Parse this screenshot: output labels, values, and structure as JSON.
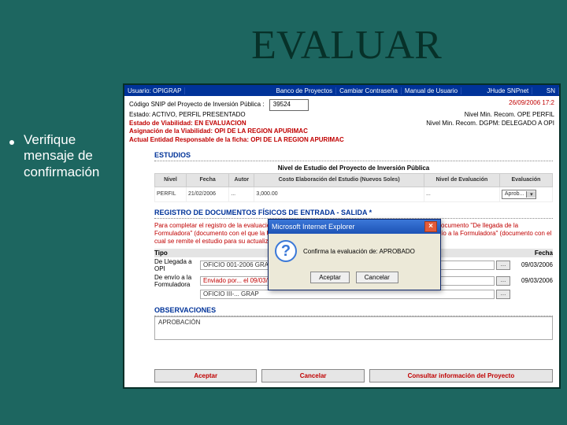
{
  "slide": {
    "title": "EVALUAR",
    "bullet": "Verifique mensaje de confirmación"
  },
  "topbar": {
    "user_label": "Usuario: OPIGRAP",
    "links": {
      "banco": "Banco de Proyectos",
      "cambiar": "Cambiar Contraseña",
      "manual": "Manual de Usuario",
      "jhude": "JHude SNPnet",
      "sn": "SN"
    },
    "timestamp": "26/09/2006 17:2"
  },
  "meta": {
    "codigo_label": "Código SNIP del Proyecto de Inversión Pública :",
    "codigo_value": "39524",
    "estado": "Estado: ACTIVO, PERFIL PRESENTADO",
    "viab": "Estado de Viabilidad: EN EVALUACION",
    "asign": "Asignación de la Viabilidad: OPI DE LA REGION APURIMAC",
    "resp": "Actual Entidad Responsable de la ficha: OPI DE LA REGION APURIMAC",
    "nmin_ope": "Nivel Min. Recom. OPE PERFIL",
    "nmin_dgpm": "Nivel Min. Recom. DGPM: DELEGADO A OPI"
  },
  "studies": {
    "title": "ESTUDIOS",
    "subtitle": "Nivel de Estudio del Proyecto de Inversión Pública",
    "headers": [
      "Nivel",
      "Fecha",
      "Autor",
      "Costo Elaboración del Estudio (Nuevos Soles)",
      "Nivel de Evaluación",
      "Evaluación"
    ],
    "row": {
      "nivel": "PERFIL",
      "fecha": "21/02/2006",
      "autor": "...",
      "costo": "3,000.00",
      "neval": "...",
      "eval_value": "Aprob..."
    }
  },
  "registro": {
    "title": "REGISTRO DE DOCUMENTOS FÍSICOS DE ENTRADA - SALIDA *",
    "warn": "Para completar el registro de la evaluación del PIP o Programa, se debe ingresar obligatoriamente el documento \"De llegada de la Formuladora\" (documento con el que la UF envía la Ficha para su evaluación) y el documento \"De envío a la Formuladora\" (documento con el cual se remite el estudio para su actualización o elaboración del siguiente nivel).",
    "col_tipo": "Tipo",
    "col_fecha": "Fecha",
    "rows": [
      {
        "label": "De Llegada a OPI",
        "value": "OFICIO 001-2006 GRAP",
        "fecha": "09/03/2006"
      },
      {
        "label": "De envío a la Formuladora",
        "value": "Enviado por... el 09/03/2006",
        "fecha": "09/03/2006"
      },
      {
        "label": "",
        "value": "OFICIO III-... GRAP",
        "fecha": ""
      }
    ]
  },
  "observ": {
    "title": "OBSERVACIONES",
    "value": "APROBACIÓN"
  },
  "buttons": {
    "aceptar": "Aceptar",
    "cancelar": "Cancelar",
    "consultar": "Consultar información del Proyecto"
  },
  "dialog": {
    "window_title": "Microsoft Internet Explorer",
    "message": "Confirma la evaluación de: APROBADO",
    "ok": "Aceptar",
    "cancel": "Cancelar"
  }
}
